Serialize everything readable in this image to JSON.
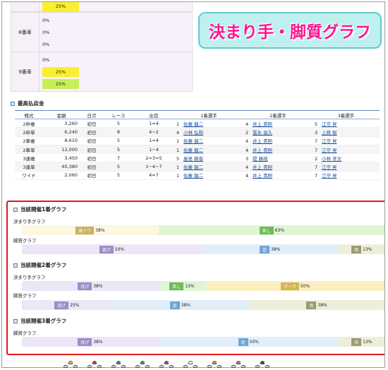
{
  "callout": "決まり手・脚質グラフ",
  "lanes": [
    {
      "label": "",
      "lines": [
        {
          "text": "25%",
          "style": "yellow"
        }
      ]
    },
    {
      "label": "8番車",
      "lines": [
        {
          "text": "0%"
        },
        {
          "text": "0%"
        },
        {
          "text": "0%"
        }
      ]
    },
    {
      "label": "9番車",
      "lines": [
        {
          "text": "0%"
        },
        {
          "text": "25%",
          "style": "yellow"
        },
        {
          "text": "25%",
          "style": "green"
        }
      ]
    }
  ],
  "payout": {
    "title": "最高払戻金",
    "headers": [
      "賭式",
      "金額",
      "日次",
      "レース",
      "出目",
      "1着選手",
      "2着選手",
      "3着選手"
    ],
    "rows": [
      {
        "type": "2枠複",
        "amount": "3,260",
        "day": "初日",
        "race": "5",
        "result": "1=4",
        "p1n": "1",
        "p1": "佐藤 龍二",
        "p2n": "4",
        "p2": "井上 貴照",
        "p3n": "5",
        "p3": "江守 昇"
      },
      {
        "type": "2枠単",
        "amount": "6,240",
        "day": "初日",
        "race": "8",
        "result": "4−2",
        "p1n": "4",
        "p1": "小林 弘和",
        "p2n": "2",
        "p2": "冨永 昌久",
        "p3n": "3",
        "p3": "上原 聡"
      },
      {
        "type": "2車複",
        "amount": "8,610",
        "day": "初日",
        "race": "5",
        "result": "1=4",
        "p1n": "1",
        "p1": "佐藤 龍二",
        "p2n": "4",
        "p2": "井上 貴照",
        "p3n": "7",
        "p3": "江守 昇"
      },
      {
        "type": "2車単",
        "amount": "12,000",
        "day": "初日",
        "race": "5",
        "result": "1−4",
        "p1n": "1",
        "p1": "佐藤 龍二",
        "p2n": "4",
        "p2": "井上 貴照",
        "p3n": "7",
        "p3": "江守 昇"
      },
      {
        "type": "3連複",
        "amount": "3,450",
        "day": "初日",
        "race": "7",
        "result": "2=3=5",
        "p1n": "5",
        "p1": "屋島 朝香",
        "p2n": "3",
        "p2": "堤 勝政",
        "p3n": "2",
        "p3": "小林 孝文"
      },
      {
        "type": "3連単",
        "amount": "40,380",
        "day": "初日",
        "race": "5",
        "result": "1−4−7",
        "p1n": "1",
        "p1": "佐藤 龍二",
        "p2n": "4",
        "p2": "井上 貴照",
        "p3n": "7",
        "p3": "江守 昇"
      },
      {
        "type": "ワイド",
        "amount": "2,060",
        "day": "初日",
        "race": "5",
        "result": "4=7",
        "p1n": "1",
        "p1": "佐藤 龍二",
        "p2n": "4",
        "p2": "井上 貴照",
        "p3n": "7",
        "p3": "江守 昇"
      }
    ]
  },
  "graphs": {
    "g1_title": "当該開催1着グラフ",
    "g1_kimarite_label": "決まり手グラフ",
    "g1_kimarite": [
      {
        "tag": "捲くり",
        "pct": 38,
        "bg": "#fdf6e0",
        "tagc": "#c8b060"
      },
      {
        "tag": "差し",
        "pct": 63,
        "bg": "#dff5d6",
        "tagc": "#6fba5a"
      }
    ],
    "g1_kyakushitsu_label": "脚質グラフ",
    "g1_kyakushitsu": [
      {
        "tag": "逃げ",
        "pct": 50,
        "bg": "#ece6f6",
        "tagc": "#9c8cc8"
      },
      {
        "tag": "追",
        "pct": 38,
        "bg": "#e1eefa",
        "tagc": "#6ea4d6"
      },
      {
        "tag": "両",
        "pct": 13,
        "bg": "#eeeedc",
        "tagc": "#9a9a70"
      }
    ],
    "g2_title": "当該開催2着グラフ",
    "g2_kimarite_label": "決まり手グラフ",
    "g2_kimarite": [
      {
        "tag": "逃げ",
        "pct": 38,
        "bg": "#ece6f6",
        "tagc": "#9c8cc8"
      },
      {
        "tag": "差し",
        "pct": 13,
        "bg": "#dff5d6",
        "tagc": "#6fba5a"
      },
      {
        "tag": "マーク",
        "pct": 50,
        "bg": "#fbefc0",
        "tagc": "#d6b650"
      }
    ],
    "g2_kyakushitsu_label": "脚質グラフ",
    "g2_kyakushitsu": [
      {
        "tag": "逃げ",
        "pct": 25,
        "bg": "#ece6f6",
        "tagc": "#9c8cc8"
      },
      {
        "tag": "追",
        "pct": 38,
        "bg": "#e1eefa",
        "tagc": "#6ea4d6"
      },
      {
        "tag": "両",
        "pct": 38,
        "bg": "#eeeedc",
        "tagc": "#9a9a70"
      }
    ],
    "g3_title": "当該開催3着グラフ",
    "g3_kyakushitsu_label": "脚質グラフ",
    "g3_kyakushitsu": [
      {
        "tag": "逃げ",
        "pct": 38,
        "bg": "#ece6f6",
        "tagc": "#9c8cc8"
      },
      {
        "tag": "追",
        "pct": 50,
        "bg": "#e1eefa",
        "tagc": "#6ea4d6"
      },
      {
        "tag": "両",
        "pct": 13,
        "bg": "#eeeedc",
        "tagc": "#9a9a70"
      }
    ]
  },
  "footer_riders": [
    "#f2c200",
    "#d43a3a",
    "#3a7ad4",
    "#2aa84a",
    "#a43ad4",
    "#ffffff",
    "#f28a1a",
    "#e85aa8",
    "#444444"
  ]
}
